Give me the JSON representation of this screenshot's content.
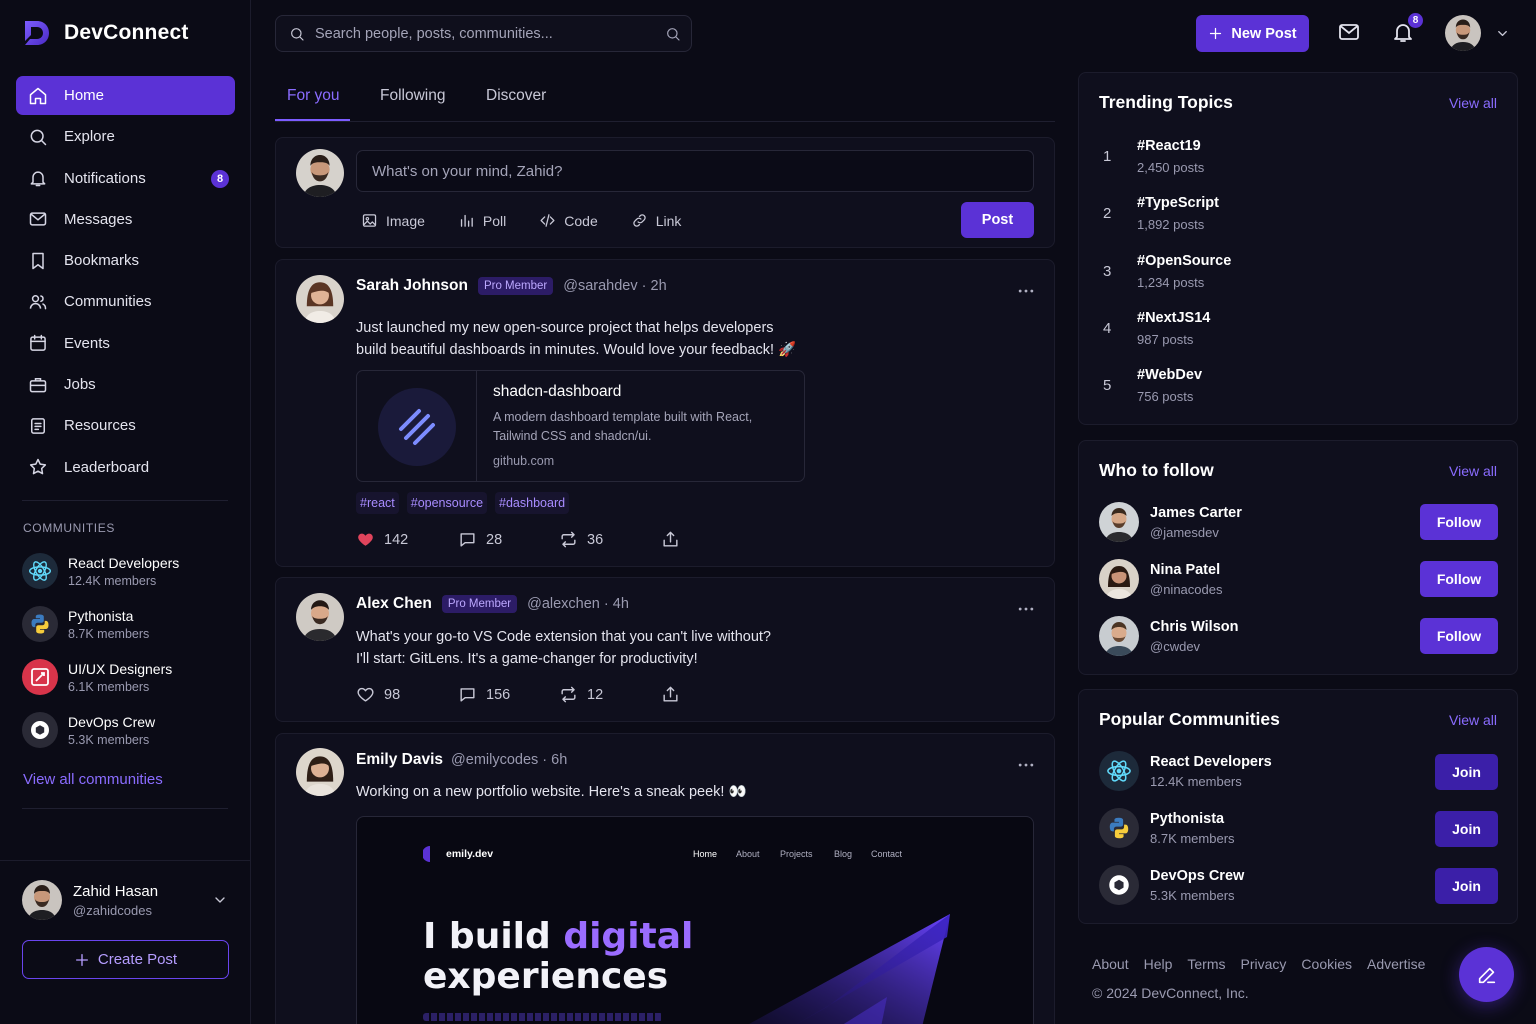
{
  "app": {
    "name": "DevConnect"
  },
  "sidebar": {
    "nav": [
      {
        "label": "Home",
        "icon": "home-icon",
        "active": true
      },
      {
        "label": "Explore",
        "icon": "search-icon"
      },
      {
        "label": "Notifications",
        "icon": "bell-icon",
        "badge": "8"
      },
      {
        "label": "Messages",
        "icon": "mail-icon"
      },
      {
        "label": "Bookmarks",
        "icon": "bookmark-icon"
      },
      {
        "label": "Communities",
        "icon": "users-icon"
      },
      {
        "label": "Events",
        "icon": "calendar-icon"
      },
      {
        "label": "Jobs",
        "icon": "briefcase-icon"
      },
      {
        "label": "Resources",
        "icon": "file-icon"
      },
      {
        "label": "Leaderboard",
        "icon": "star-icon"
      }
    ],
    "communities_title": "COMMUNITIES",
    "communities": [
      {
        "name": "React Developers",
        "members": "12.4K members",
        "icon": "react-icon"
      },
      {
        "name": "Pythonista",
        "members": "8.7K members",
        "icon": "python-icon"
      },
      {
        "name": "UI/UX Designers",
        "members": "6.1K members",
        "icon": "design-icon"
      },
      {
        "name": "DevOps Crew",
        "members": "5.3K members",
        "icon": "devops-icon"
      }
    ],
    "view_all_communities": "View all communities",
    "profile": {
      "name": "Zahid Hasan",
      "handle": "@zahidcodes"
    },
    "create_post": "Create Post"
  },
  "topbar": {
    "search_placeholder": "Search people, posts, communities...",
    "new_post": "New Post",
    "notification_count": "8"
  },
  "feed": {
    "tabs": [
      "For you",
      "Following",
      "Discover"
    ],
    "active_tab": "For you",
    "compose": {
      "placeholder": "What's on your mind, Zahid?",
      "actions": [
        "Image",
        "Poll",
        "Code",
        "Link"
      ],
      "post_button": "Post"
    },
    "posts": [
      {
        "author": "Sarah Johnson",
        "badge": "Pro Member",
        "handle": "@sarahdev",
        "time": "2h",
        "text_line1": "Just launched my new open-source project that helps developers",
        "text_line2": "build beautiful dashboards in minutes. Would love your feedback! 🚀",
        "link": {
          "title": "shadcn-dashboard",
          "desc_line1": "A modern dashboard template built with React,",
          "desc_line2": "Tailwind CSS and shadcn/ui.",
          "domain": "github.com"
        },
        "tags": [
          "#react",
          "#opensource",
          "#dashboard"
        ],
        "likes": "142",
        "comments": "28",
        "reposts": "36",
        "liked": true
      },
      {
        "author": "Alex Chen",
        "badge": "Pro Member",
        "handle": "@alexchen",
        "time": "4h",
        "text_line1": "What's your go-to VS Code extension that you can't live without?",
        "text_line2": "I'll start: GitLens. It's a game-changer for productivity!",
        "likes": "98",
        "comments": "156",
        "reposts": "12",
        "liked": false
      },
      {
        "author": "Emily Davis",
        "handle": "@emilycodes",
        "time": "6h",
        "text_line1": "Working on a new portfolio website. Here's a sneak peek! 👀",
        "preview": {
          "site": "emily.dev",
          "nav": [
            "Home",
            "About",
            "Projects",
            "Blog",
            "Contact"
          ],
          "headline_a": "I build ",
          "headline_b": "digital",
          "headline_c": "experiences"
        }
      }
    ]
  },
  "right": {
    "trending": {
      "title": "Trending Topics",
      "view_all": "View all",
      "items": [
        {
          "rank": "1",
          "tag": "#React19",
          "count": "2,450 posts"
        },
        {
          "rank": "2",
          "tag": "#TypeScript",
          "count": "1,892 posts"
        },
        {
          "rank": "3",
          "tag": "#OpenSource",
          "count": "1,234 posts"
        },
        {
          "rank": "4",
          "tag": "#NextJS14",
          "count": "987 posts"
        },
        {
          "rank": "5",
          "tag": "#WebDev",
          "count": "756 posts"
        }
      ]
    },
    "who_to_follow": {
      "title": "Who to follow",
      "view_all": "View all",
      "people": [
        {
          "name": "James Carter",
          "handle": "@jamesdev",
          "button": "Follow"
        },
        {
          "name": "Nina Patel",
          "handle": "@ninacodes",
          "button": "Follow"
        },
        {
          "name": "Chris Wilson",
          "handle": "@cwdev",
          "button": "Follow"
        }
      ]
    },
    "popular": {
      "title": "Popular Communities",
      "view_all": "View all",
      "items": [
        {
          "name": "React Developers",
          "members": "12.4K members",
          "button": "Join"
        },
        {
          "name": "Pythonista",
          "members": "8.7K members",
          "button": "Join"
        },
        {
          "name": "DevOps Crew",
          "members": "5.3K members",
          "button": "Join"
        }
      ]
    },
    "footer_links": [
      "About",
      "Help",
      "Terms",
      "Privacy",
      "Cookies",
      "Advertise"
    ],
    "copyright": "© 2024 DevConnect, Inc."
  },
  "colors": {
    "accent": "#5b32d6",
    "accent_light": "#8a6cff",
    "background": "#0b0b16",
    "card": "#0f0f1d"
  }
}
